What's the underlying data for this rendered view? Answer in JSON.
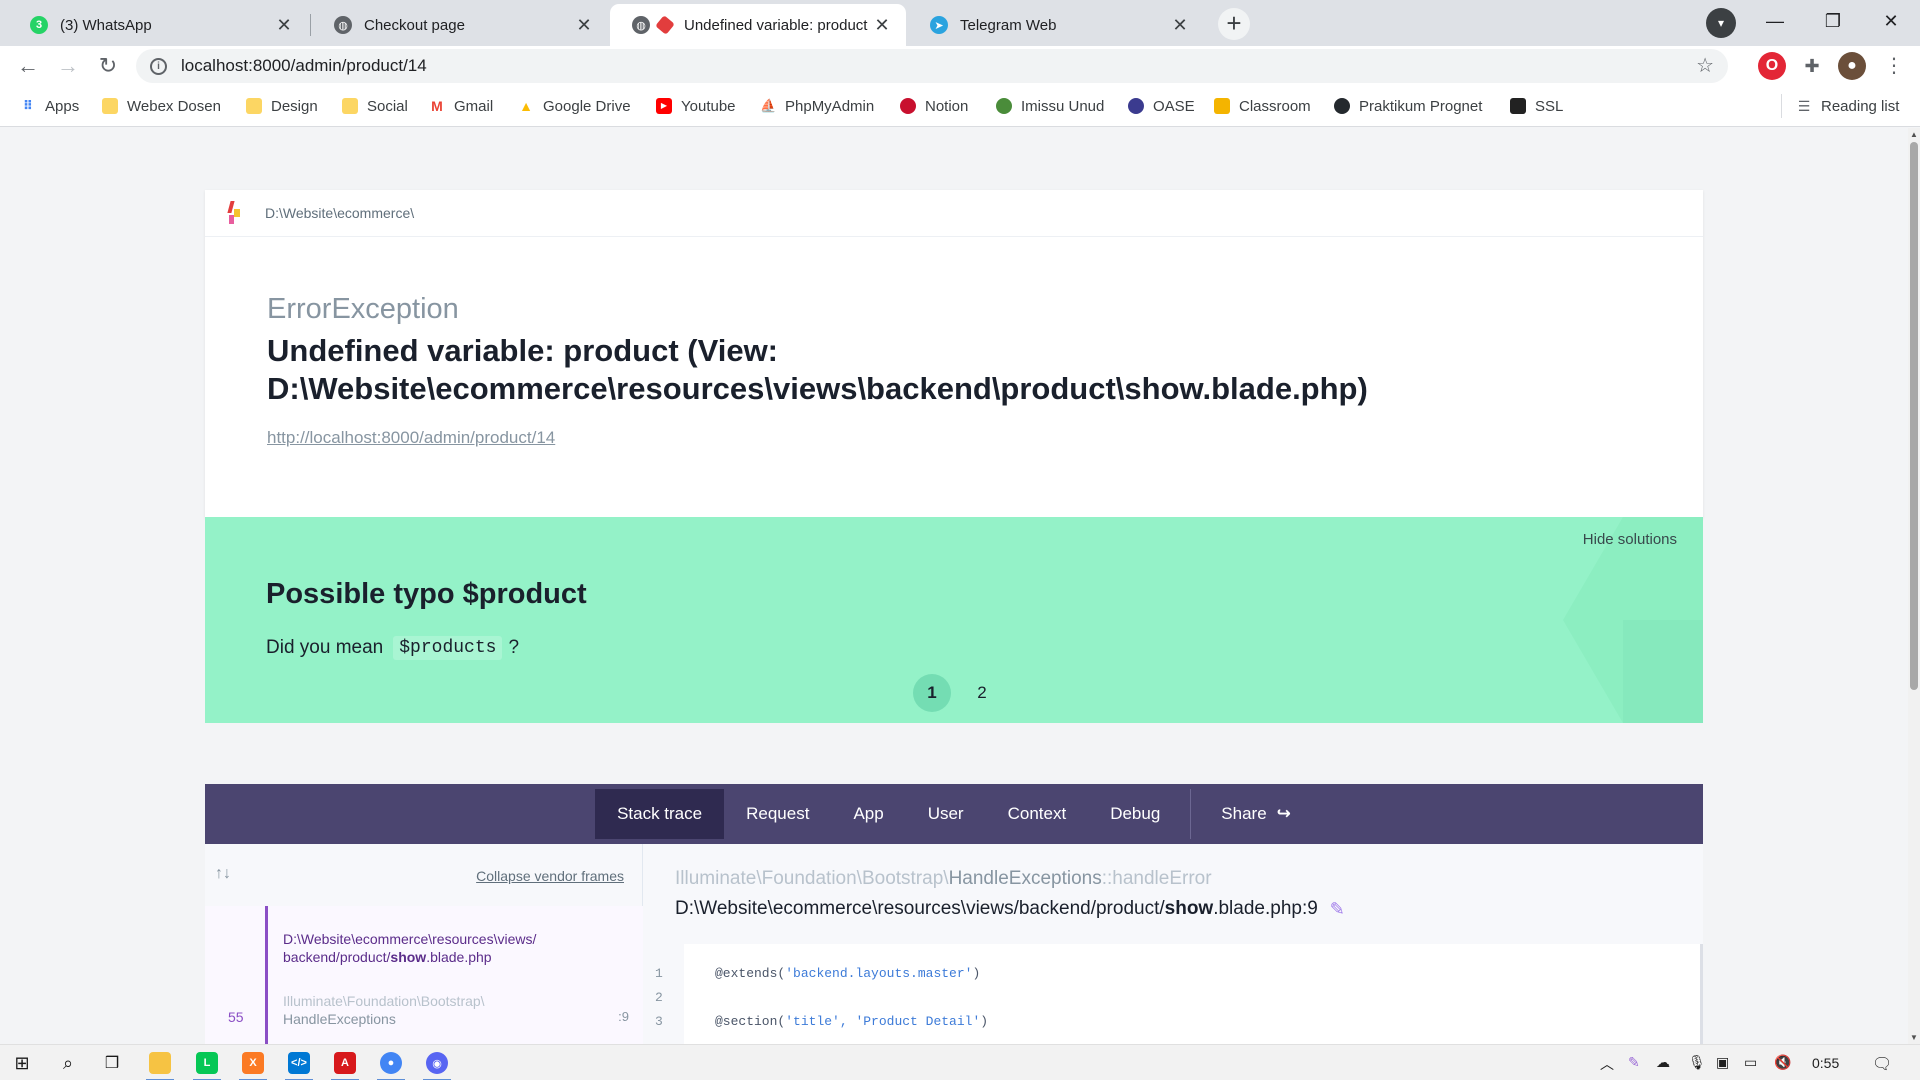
{
  "browser": {
    "tabs": [
      {
        "title": "(3) WhatsApp",
        "icon": "whatsapp-icon",
        "color": "#25d366"
      },
      {
        "title": "Checkout page",
        "icon": "globe-icon",
        "color": "#5f6368"
      },
      {
        "title": "Undefined variable: product (",
        "icon": "ignition-icon",
        "color": "#e23d3d"
      },
      {
        "title": "Telegram Web",
        "icon": "telegram-icon",
        "color": "#2aa3df"
      }
    ],
    "url": "localhost:8000/admin/product/14",
    "bookmarks": [
      {
        "label": "Apps",
        "icon": "apps-grid-icon"
      },
      {
        "label": "Webex Dosen",
        "icon": "folder-icon"
      },
      {
        "label": "Design",
        "icon": "folder-icon"
      },
      {
        "label": "Social",
        "icon": "folder-icon"
      },
      {
        "label": "Gmail",
        "icon": "gmail-icon"
      },
      {
        "label": "Google Drive",
        "icon": "google-drive-icon"
      },
      {
        "label": "Youtube",
        "icon": "youtube-icon"
      },
      {
        "label": "PhpMyAdmin",
        "icon": "phpmyadmin-icon"
      },
      {
        "label": "Notion",
        "icon": "notion-icon"
      },
      {
        "label": "Imissu Unud",
        "icon": "imissu-icon"
      },
      {
        "label": "OASE",
        "icon": "oase-icon"
      },
      {
        "label": "Classroom",
        "icon": "classroom-icon"
      },
      {
        "label": "Praktikum Prognet",
        "icon": "github-icon"
      },
      {
        "label": "SSL",
        "icon": "ssl-icon"
      }
    ],
    "reading_list": "Reading list"
  },
  "ignition": {
    "path": "D:\\Website\\ecommerce\\",
    "exception_class": "ErrorException",
    "exception_message": "Undefined variable: product (View: D:\\Website\\ecommerce\\resources\\views\\backend\\product\\show.blade.php)",
    "request_url": "http://localhost:8000/admin/product/14",
    "solution": {
      "hide_label": "Hide solutions",
      "title": "Possible typo $product",
      "desc_prefix": "Did you mean",
      "desc_code": "$products",
      "desc_suffix": "?",
      "pages": [
        "1",
        "2"
      ],
      "active_page": 1
    },
    "nav_tabs": [
      "Stack trace",
      "Request",
      "App",
      "User",
      "Context",
      "Debug"
    ],
    "share_label": "Share",
    "collapse_vendor": "Collapse vendor frames",
    "frame": {
      "path": "D:\\Website\\ecommerce\\resources\\views\\backend/product/show.blade.php",
      "path_line1": "D:\\Website\\ecommerce\\resources\\views/",
      "path_line2_pre": "backend/product/",
      "path_line2_bold": "show",
      "path_line2_post": ".blade.php",
      "class_ns": "Illuminate\\Foundation\\Bootstrap\\",
      "class_name": "HandleExceptions",
      "number": "55",
      "line": ":9"
    },
    "code_header": {
      "namespace": "Illuminate\\Foundation\\Bootstrap\\",
      "class": "HandleExceptions",
      "method": "::handleError",
      "file_pre": "D:\\Website\\ecommerce\\resources\\views/backend/product/",
      "file_bold": "show",
      "file_post": ".blade.php:9"
    },
    "code_lines": [
      {
        "n": "1",
        "directive": "@extends",
        "open": "(",
        "args": "'backend.layouts.master'",
        "close": ")"
      },
      {
        "n": "2",
        "directive": "",
        "open": "",
        "args": "",
        "close": ""
      },
      {
        "n": "3",
        "directive": "@section",
        "open": "(",
        "args": "'title', 'Product Detail'",
        "close": ")"
      }
    ]
  },
  "taskbar": {
    "clock": "0:55",
    "apps": [
      "start-icon",
      "search-icon",
      "task-view-icon",
      "file-explorer-icon",
      "line-icon",
      "xampp-icon",
      "vscode-icon",
      "acrobat-icon",
      "chrome-icon",
      "discord-icon"
    ]
  },
  "colors": {
    "solution_bg": "#94f2c8",
    "nav_bg": "#4b4570",
    "nav_active": "#2f2a50",
    "accent_purple": "#8b4fc5"
  }
}
